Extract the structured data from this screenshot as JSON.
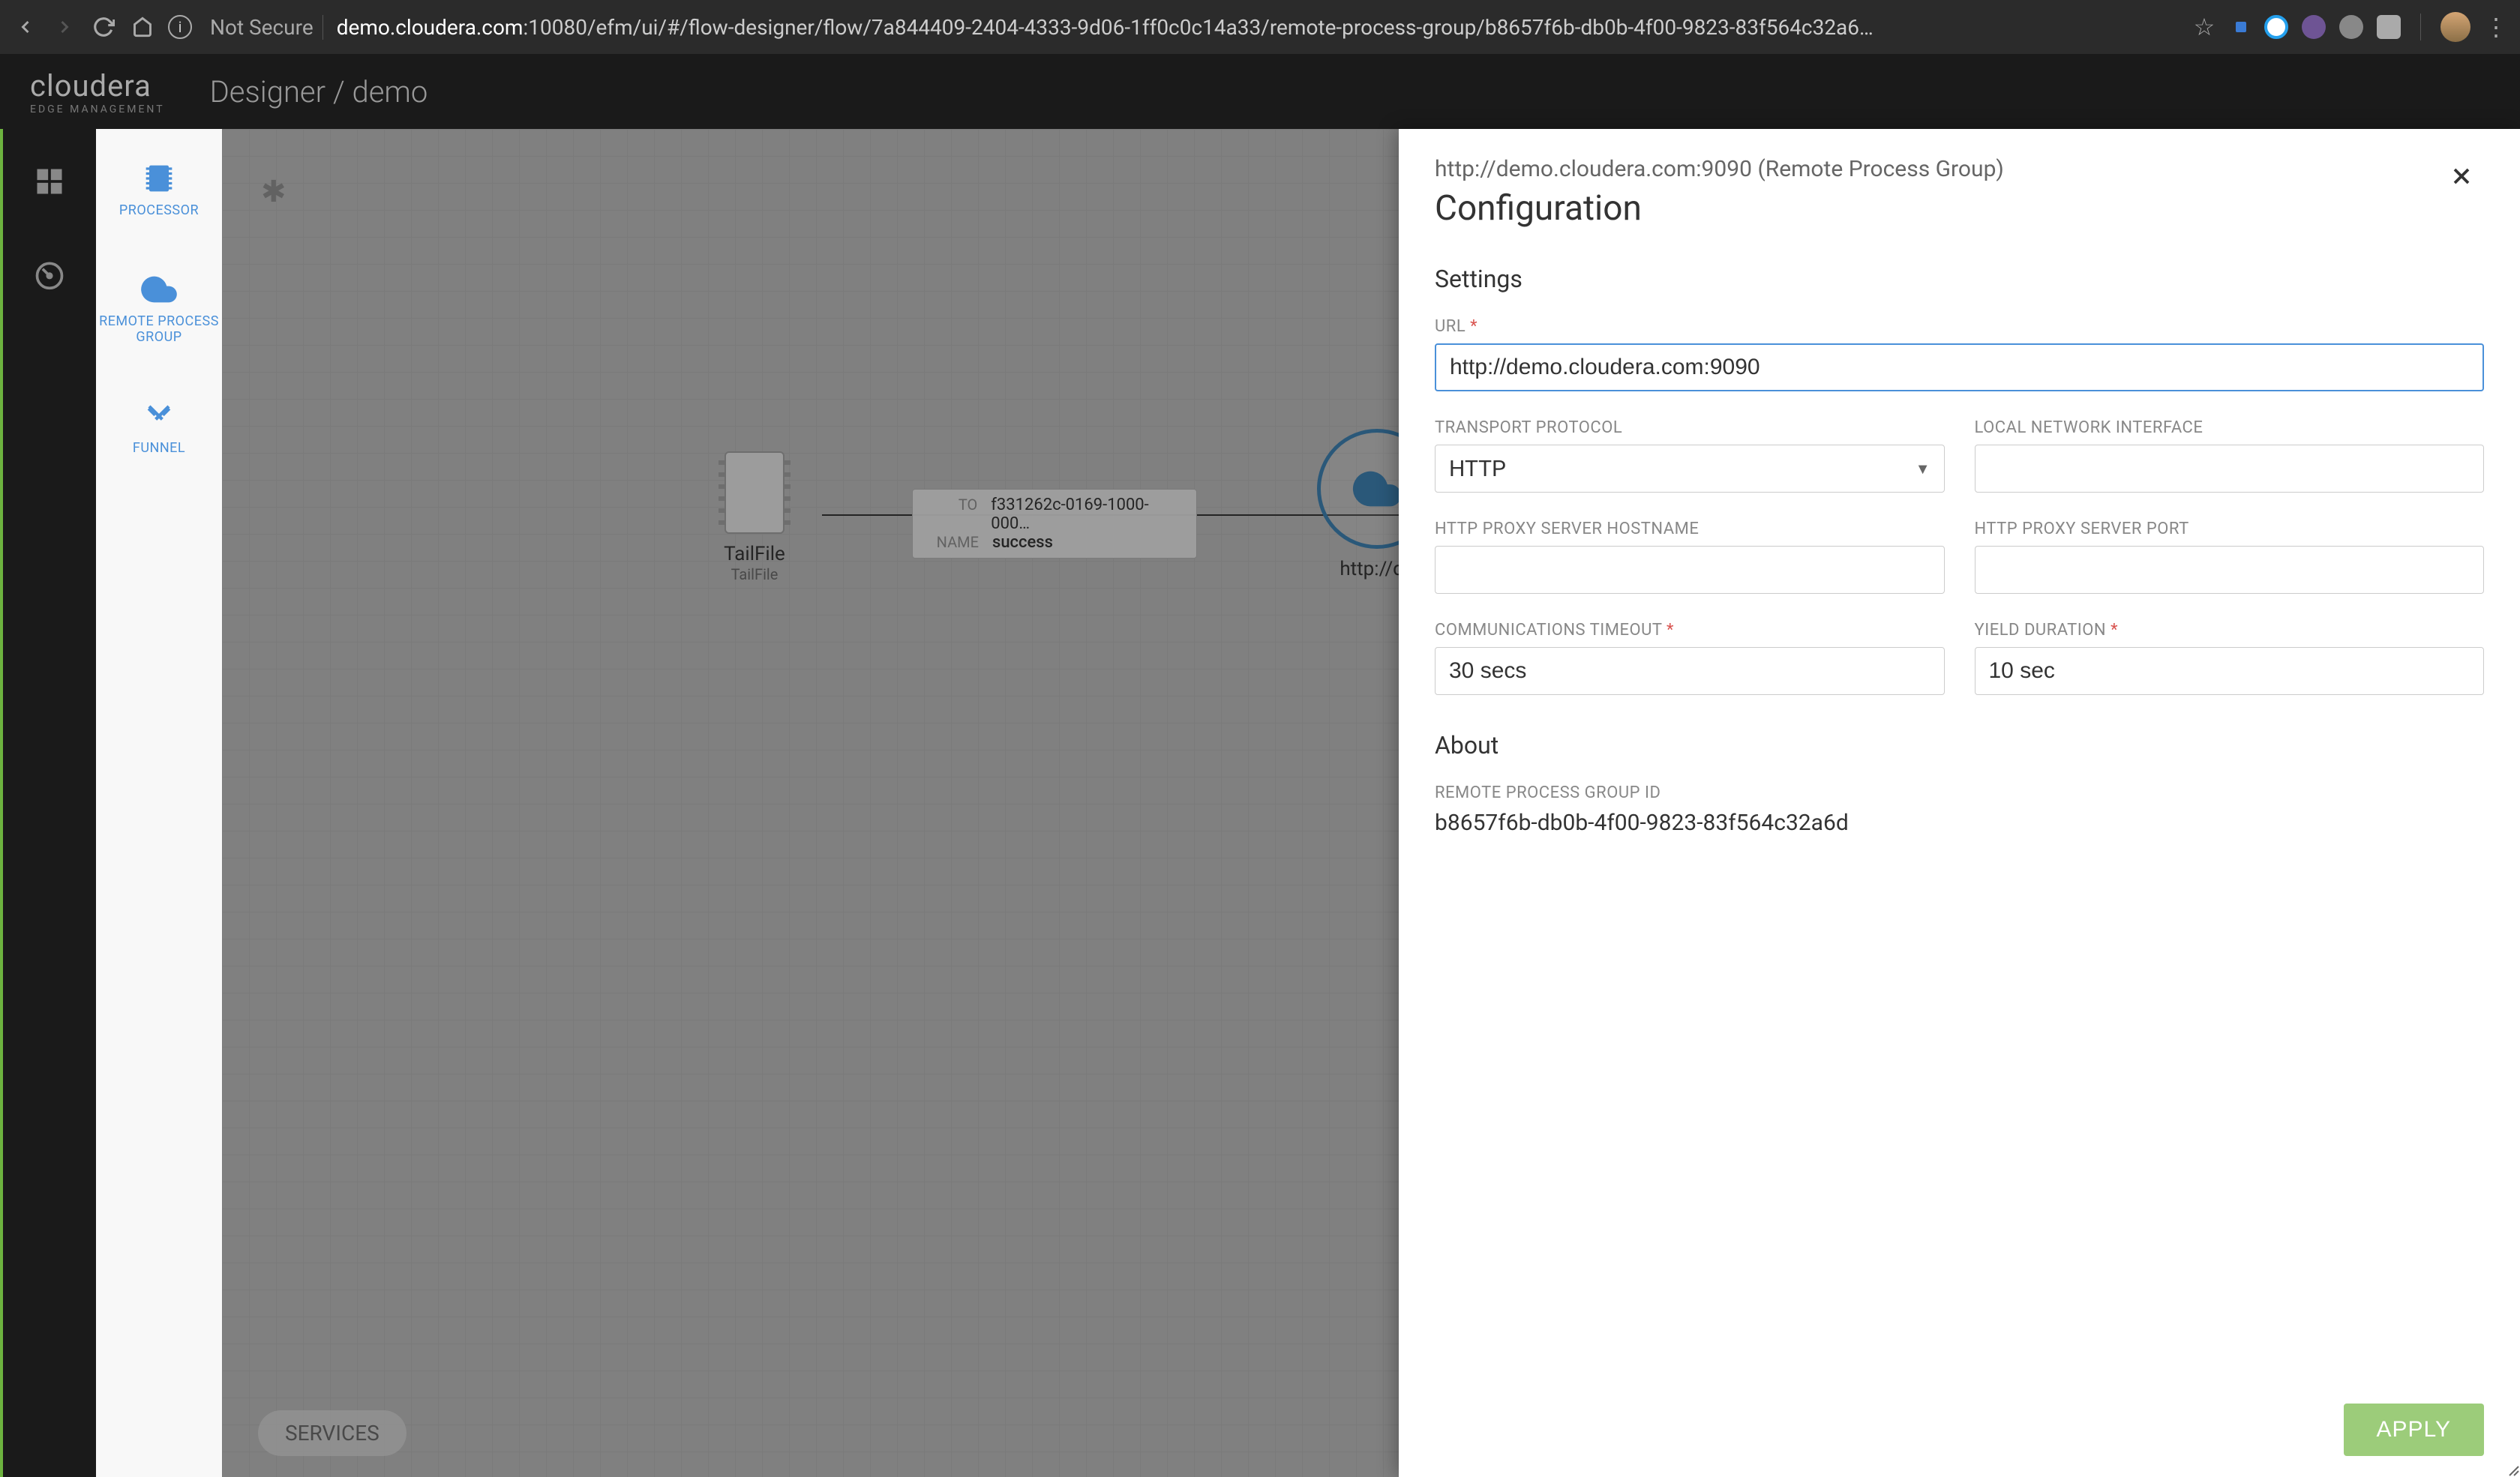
{
  "browser": {
    "not_secure": "Not Secure",
    "url_host": "demo.cloudera.com",
    "url_path": ":10080/efm/ui/#/flow-designer/flow/7a844409-2404-4333-9d06-1ff0c0c14a33/remote-process-group/b8657f6b-db0b-4f00-9823-83f564c32a6…"
  },
  "header": {
    "logo": "cloudera",
    "logo_sub": "EDGE MANAGEMENT",
    "breadcrumb": "Designer / demo"
  },
  "sidebar": {
    "items": [
      {
        "label": "PROCESSOR"
      },
      {
        "label": "REMOTE PROCESS GROUP"
      },
      {
        "label": "FUNNEL"
      }
    ]
  },
  "canvas": {
    "processor": {
      "name": "TailFile",
      "type": "TailFile"
    },
    "connection": {
      "to": "f331262c-0169-1000-000…",
      "name": "success"
    },
    "rpg_url_text": "http://de",
    "services": "SERVICES"
  },
  "config": {
    "subtitle": "http://demo.cloudera.com:9090 (Remote Process Group)",
    "title": "Configuration",
    "sections": {
      "settings": "Settings",
      "about": "About"
    },
    "fields": {
      "url": {
        "label": "URL",
        "required": "*",
        "value": "http://demo.cloudera.com:9090"
      },
      "transport": {
        "label": "TRANSPORT PROTOCOL",
        "value": "HTTP"
      },
      "lni": {
        "label": "LOCAL NETWORK INTERFACE",
        "value": ""
      },
      "proxy_host": {
        "label": "HTTP PROXY SERVER HOSTNAME",
        "value": ""
      },
      "proxy_port": {
        "label": "HTTP PROXY SERVER PORT",
        "value": ""
      },
      "comm_timeout": {
        "label": "COMMUNICATIONS TIMEOUT",
        "required": "*",
        "value": "30 secs"
      },
      "yield": {
        "label": "YIELD DURATION",
        "required": "*",
        "value": "10 sec"
      }
    },
    "about": {
      "rpg_id": {
        "label": "REMOTE PROCESS GROUP ID",
        "value": "b8657f6b-db0b-4f00-9823-83f564c32a6d"
      }
    },
    "apply": "APPLY"
  }
}
